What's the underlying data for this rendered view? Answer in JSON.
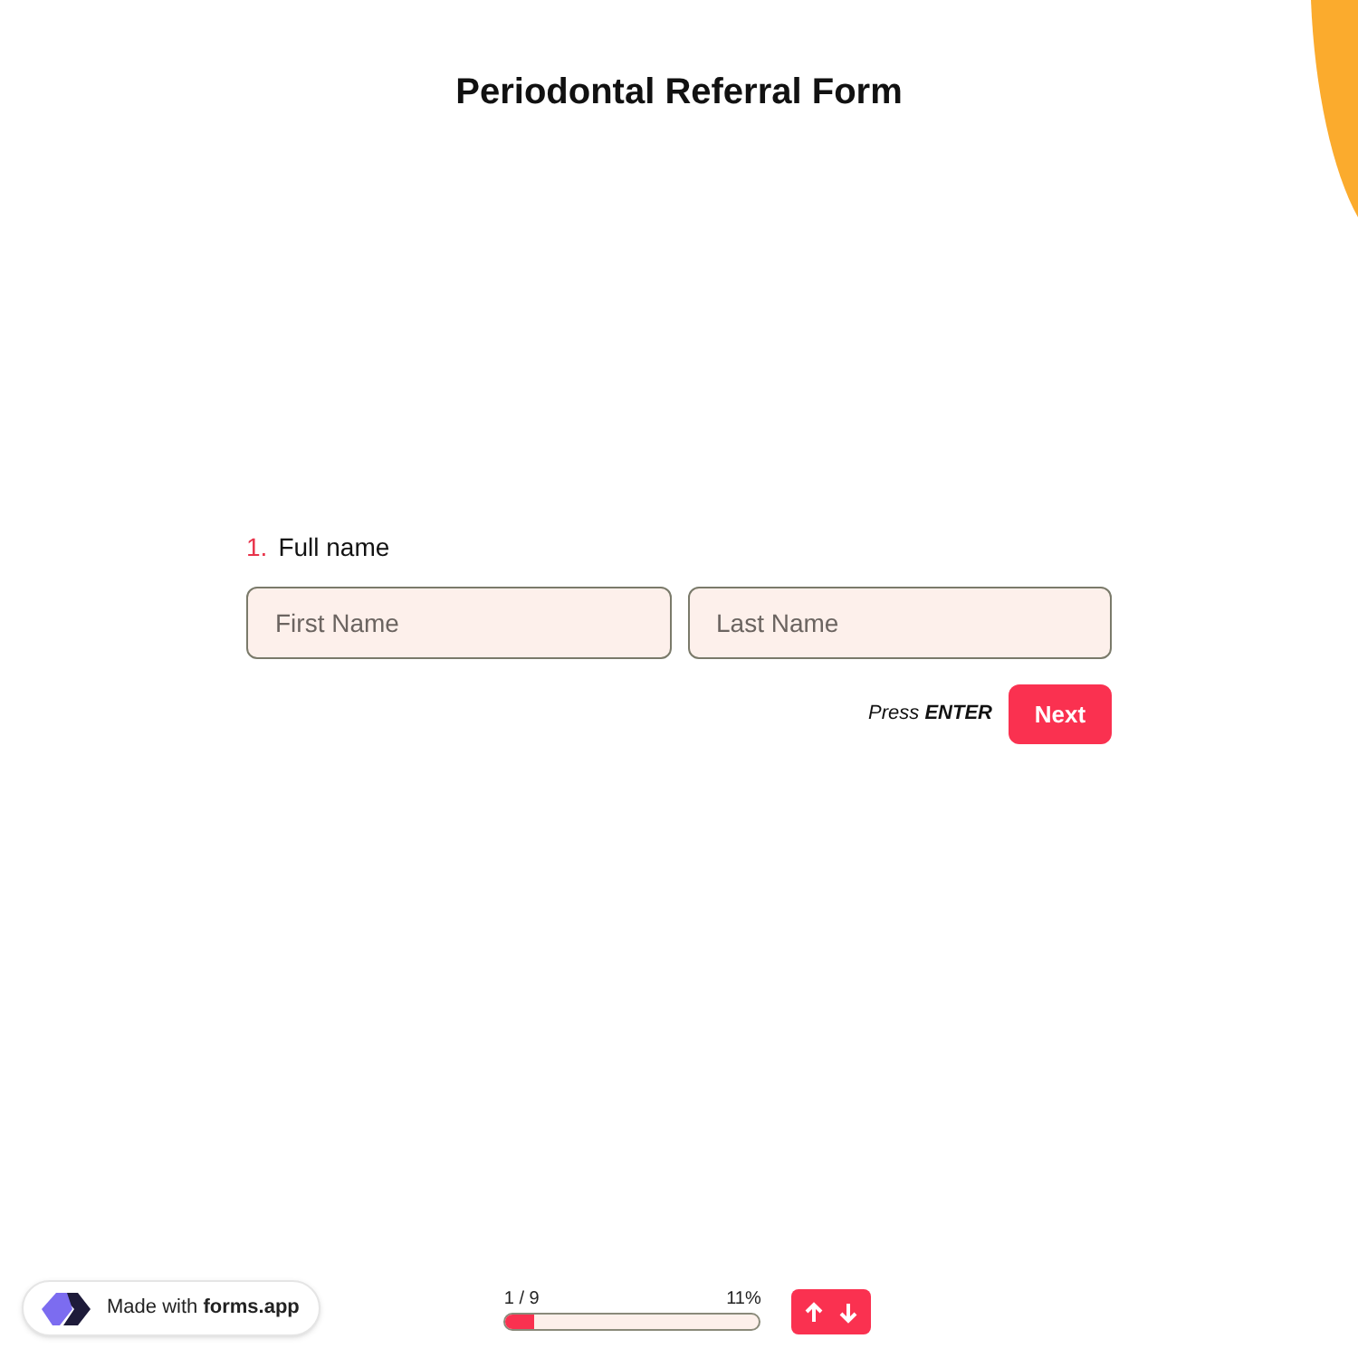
{
  "title": "Periodontal Referral Form",
  "question": {
    "number": "1.",
    "label": "Full name",
    "fields": [
      {
        "placeholder": "First Name"
      },
      {
        "placeholder": "Last Name"
      }
    ]
  },
  "hint": "Press **ENTER**",
  "next_button": "Next",
  "badge": {
    "text": "Made with **forms.app**"
  },
  "progress": {
    "count": "1 / 9",
    "percent": "11%",
    "level": 0.11
  }
}
